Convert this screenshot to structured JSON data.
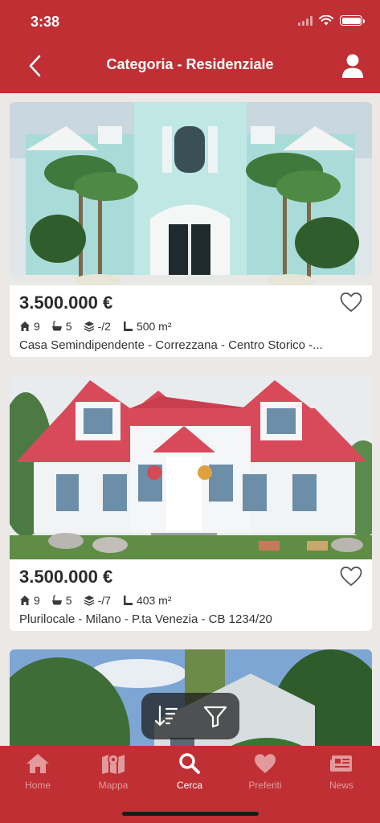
{
  "status": {
    "time": "3:38"
  },
  "header": {
    "title": "Categoria - Residenziale"
  },
  "listings": [
    {
      "price": "3.500.000 €",
      "rooms": "9",
      "baths": "5",
      "floors": "-/2",
      "area": "500 m²",
      "description": "Casa Semindipendente - Correzzana - Centro Storico -..."
    },
    {
      "price": "3.500.000 €",
      "rooms": "9",
      "baths": "5",
      "floors": "-/7",
      "area": "403 m²",
      "description": "Plurilocale - Milano - P.ta Venezia - CB 1234/20"
    }
  ],
  "tabbar": {
    "tabs": [
      {
        "label": "Home",
        "icon": "home-icon"
      },
      {
        "label": "Mappa",
        "icon": "map-icon"
      },
      {
        "label": "Cerca",
        "icon": "search-icon"
      },
      {
        "label": "Preferiti",
        "icon": "heart-icon"
      },
      {
        "label": "News",
        "icon": "news-icon"
      }
    ],
    "active_index": 2
  },
  "colors": {
    "brand": "#c02f34",
    "tab_inactive": "#e39a9c",
    "background": "#ebe8e6"
  }
}
